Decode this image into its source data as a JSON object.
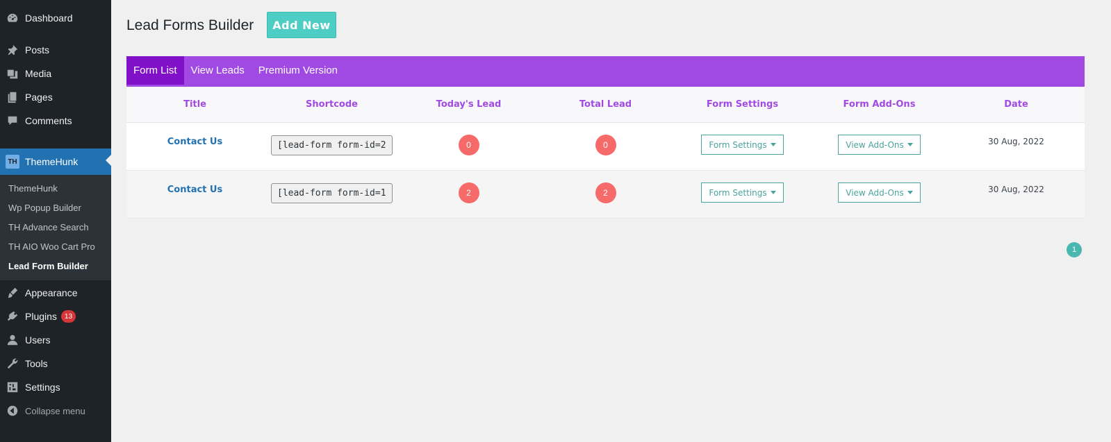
{
  "sidebar": {
    "dashboard": "Dashboard",
    "posts": "Posts",
    "media": "Media",
    "pages": "Pages",
    "comments": "Comments",
    "themehunk": "ThemeHunk",
    "themehunk_logo": "TH",
    "submenu": [
      "ThemeHunk",
      "Wp Popup Builder",
      "TH Advance Search",
      "TH AIO Woo Cart Pro",
      "Lead Form Builder"
    ],
    "appearance": "Appearance",
    "plugins": "Plugins",
    "plugins_badge": "13",
    "users": "Users",
    "tools": "Tools",
    "settings": "Settings",
    "collapse": "Collapse menu"
  },
  "header": {
    "title": "Lead Forms Builder",
    "add_new": "Add New"
  },
  "tabs": [
    "Form List",
    "View Leads",
    "Premium Version"
  ],
  "table": {
    "columns": [
      "Title",
      "Shortcode",
      "Today's Lead",
      "Total Lead",
      "Form Settings",
      "Form Add-Ons",
      "Date"
    ],
    "rows": [
      {
        "title": "Contact Us",
        "shortcode": "[lead-form form-id=2",
        "today": "0",
        "total": "0",
        "settings": "Form Settings",
        "addons": "View Add-Ons",
        "date": "30 Aug, 2022"
      },
      {
        "title": "Contact Us",
        "shortcode": "[lead-form form-id=1",
        "today": "2",
        "total": "2",
        "settings": "Form Settings",
        "addons": "View Add-Ons",
        "date": "30 Aug, 2022"
      }
    ]
  },
  "pagination": {
    "current": "1"
  },
  "colors": {
    "accent": "#a14ae3",
    "tab_active": "#8111c9",
    "teal": "#4ecdc4",
    "lead_circle": "#f76a6a",
    "link": "#2271b1"
  }
}
